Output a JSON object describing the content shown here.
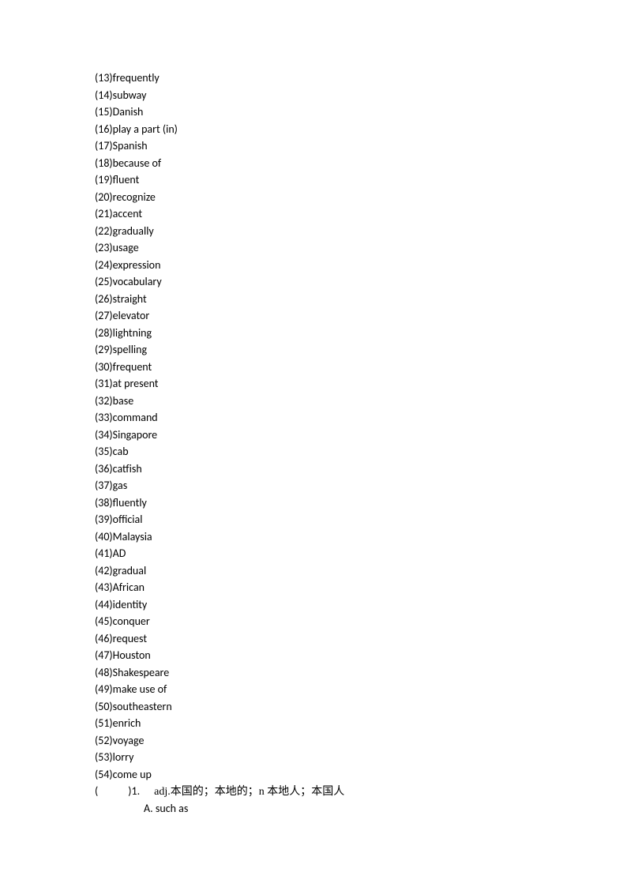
{
  "items": [
    "(13)frequently",
    "(14)subway",
    "(15)Danish",
    "(16)play a part (in)",
    "(17)Spanish",
    "(18)because of",
    "(19)fluent",
    "(20)recognize",
    "(21)accent",
    "(22)gradually",
    "(23)usage",
    "(24)expression",
    "(25)vocabulary",
    "(26)straight",
    "(27)elevator",
    "(28)lightning",
    "(29)spelling",
    "(30)frequent",
    "(31)at present",
    "(32)base",
    "(33)command",
    "(34)Singapore",
    "(35)cab",
    "(36)catfish",
    "(37)gas",
    "(38)fluently",
    "(39)official",
    "(40)Malaysia",
    "(41)AD",
    "(42)gradual",
    "(43)African",
    "(44)identity",
    "(45)conquer",
    "(46)request",
    "(47)Houston",
    "(48)Shakespeare",
    "(49)make use of",
    "(50)southeastern",
    "(51)enrich",
    "(52)voyage",
    "(53)lorry",
    "(54)come up"
  ],
  "question": {
    "open": "(",
    "close": ")1.",
    "text": "adj.本国的；本地的；n 本地人；本国人"
  },
  "option": "A. such as"
}
